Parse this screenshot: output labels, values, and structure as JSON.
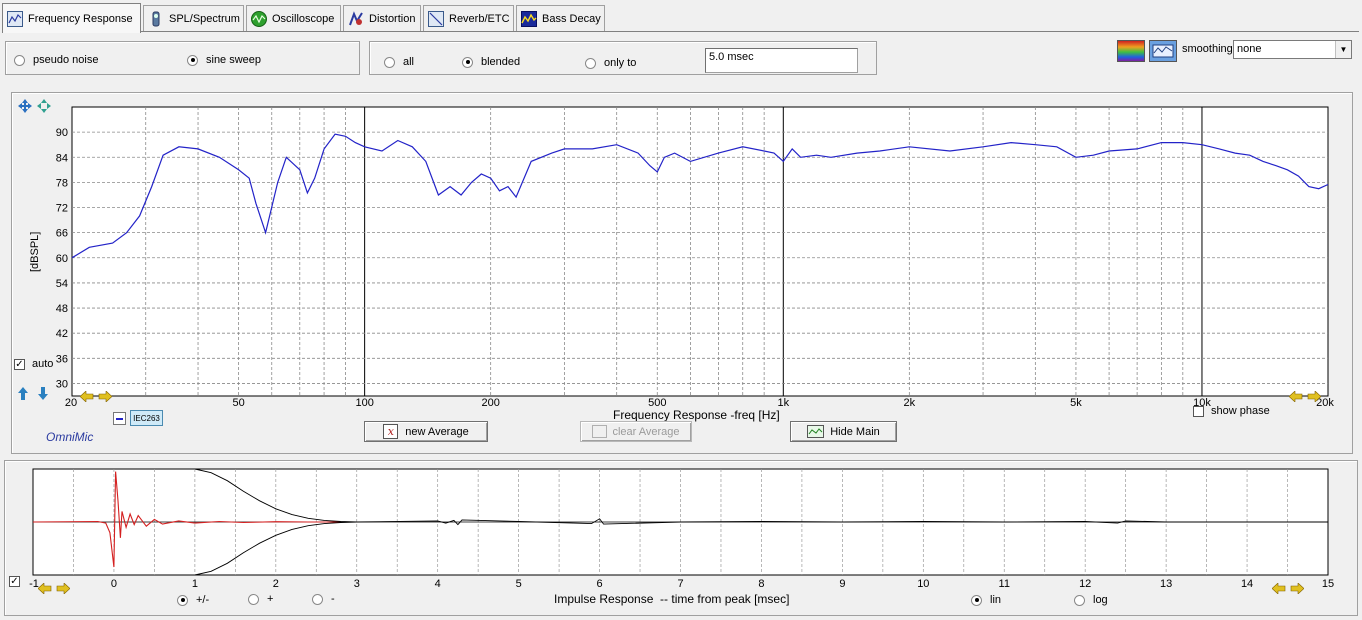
{
  "tabs": [
    {
      "label": "Frequency Response",
      "icon": "frequency-response-icon",
      "active": true
    },
    {
      "label": "SPL/Spectrum",
      "icon": "spl-meter-icon",
      "active": false
    },
    {
      "label": "Oscilloscope",
      "icon": "oscilloscope-icon",
      "active": false
    },
    {
      "label": "Distortion",
      "icon": "distortion-icon",
      "active": false
    },
    {
      "label": "Reverb/ETC",
      "icon": "reverb-icon",
      "active": false
    },
    {
      "label": "Bass Decay",
      "icon": "waterfall-icon",
      "active": false
    }
  ],
  "stimulus": {
    "options": [
      "pseudo noise",
      "sine sweep"
    ],
    "selected": "sine sweep"
  },
  "window": {
    "options": [
      "all",
      "blended",
      "only to"
    ],
    "selected": "blended",
    "only_to_value": "5.0 msec"
  },
  "smoothing": {
    "label": "smoothing",
    "value": "none"
  },
  "freq_plot": {
    "xlabel": "Frequency Response -freq [Hz]",
    "ylabel": "[dBSPL]",
    "auto_label": "auto",
    "auto_checked": true,
    "show_phase_label": "show phase",
    "show_phase_checked": false,
    "brand": "OmniMic",
    "legend_label": "IEC263",
    "line_color": "#2323c8"
  },
  "buttons": {
    "new_average": "new Average",
    "clear_average": "clear Average",
    "hide_main": "Hide Main"
  },
  "impulse_plot": {
    "xlabel": "Impulse Response  -- time from peak [msec]",
    "polarity_options": [
      "+/-",
      "+",
      "-"
    ],
    "polarity_selected": "+/-",
    "scale_options": [
      "lin",
      "log"
    ],
    "scale_selected": "lin",
    "checkbox_checked": true,
    "line_color": "#d42020"
  },
  "chart_data": [
    {
      "type": "line",
      "title": "",
      "xlabel": "Frequency Response -freq [Hz]",
      "ylabel": "[dBSPL]",
      "xscale": "log",
      "xlim": [
        20,
        20000
      ],
      "ylim": [
        27,
        96
      ],
      "x_ticks": [
        20,
        50,
        100,
        200,
        500,
        1000,
        2000,
        5000,
        10000,
        20000
      ],
      "x_tick_labels": [
        "20",
        "50",
        "100",
        "200",
        "500",
        "1k",
        "2k",
        "5k",
        "10k",
        "20k"
      ],
      "y_ticks": [
        30,
        36,
        42,
        48,
        54,
        60,
        66,
        72,
        78,
        84,
        90
      ],
      "y_tick_labels": [
        "30",
        "36",
        "42",
        "48",
        "54",
        "60",
        "66",
        "72",
        "78",
        "84",
        "90"
      ],
      "grid": true,
      "series": [
        {
          "x": [
            20,
            22,
            25,
            27,
            29,
            31,
            33,
            36,
            40,
            45,
            50,
            53,
            55,
            58,
            62,
            65,
            70,
            73,
            76,
            80,
            85,
            90,
            95,
            100,
            110,
            120,
            130,
            140,
            150,
            160,
            170,
            180,
            190,
            200,
            210,
            220,
            230,
            250,
            280,
            300,
            350,
            400,
            450,
            480,
            500,
            520,
            550,
            600,
            700,
            800,
            900,
            950,
            1000,
            1050,
            1100,
            1200,
            1300,
            1500,
            1700,
            2000,
            2500,
            3000,
            3500,
            4000,
            4500,
            5000,
            5500,
            6000,
            7000,
            8000,
            9000,
            10000,
            11000,
            12000,
            13000,
            14000,
            15000,
            16000,
            17000,
            18000,
            19000,
            20000
          ],
          "y": [
            60,
            62.5,
            63.5,
            66,
            70,
            77,
            84.5,
            86.5,
            86,
            84,
            81,
            79,
            73,
            66,
            78,
            84,
            81,
            75.5,
            79,
            86,
            89.5,
            89,
            87.5,
            86.5,
            85.5,
            88,
            86.5,
            83,
            75,
            77,
            75,
            78,
            80,
            79,
            76,
            77,
            74.5,
            83,
            85,
            86,
            86,
            87,
            85,
            82,
            80.5,
            84,
            85,
            83,
            85,
            86.5,
            85.5,
            85,
            83,
            86,
            84,
            84.5,
            84,
            85,
            85.5,
            86.5,
            85.5,
            86.5,
            87.5,
            87,
            86.5,
            84,
            84.5,
            85.5,
            86,
            87.5,
            87.5,
            87,
            86,
            85,
            84.5,
            83,
            82,
            81,
            79.5,
            77,
            76.5,
            77.5
          ]
        }
      ]
    },
    {
      "type": "line",
      "title": "",
      "xlabel": "Impulse Response  -- time from peak [msec]",
      "ylabel": "",
      "xlim": [
        -1,
        15
      ],
      "ylim": [
        -1,
        1
      ],
      "x_ticks": [
        -1,
        0,
        1,
        2,
        3,
        4,
        5,
        6,
        7,
        8,
        9,
        10,
        11,
        12,
        13,
        14,
        15
      ],
      "x_tick_labels": [
        "-1",
        "0",
        "1",
        "2",
        "3",
        "4",
        "5",
        "6",
        "7",
        "8",
        "9",
        "10",
        "11",
        "12",
        "13",
        "14",
        "15"
      ],
      "grid": true,
      "series": [
        {
          "x": [
            -1,
            -0.2,
            -0.1,
            -0.05,
            0,
            0.02,
            0.05,
            0.08,
            0.1,
            0.15,
            0.2,
            0.25,
            0.3,
            0.4,
            0.5,
            0.6,
            0.8,
            1.0,
            1.3,
            1.6,
            2.0,
            2.4,
            3.0
          ],
          "y": [
            0,
            0.01,
            -0.02,
            -0.2,
            -0.85,
            0.95,
            0.4,
            -0.3,
            0.2,
            -0.1,
            0.15,
            -0.05,
            0.12,
            -0.08,
            0.05,
            -0.04,
            0.02,
            -0.02,
            0.01,
            -0.01,
            0.005,
            0,
            0
          ]
        },
        {
          "x": [
            3.0,
            4.0,
            4.1,
            4.2,
            4.25,
            4.3,
            5.0,
            5.9,
            6.0,
            6.05,
            7.0,
            8.0,
            9.0,
            10.0,
            11.0,
            12.0,
            12.4,
            12.5,
            13.0,
            14.0,
            15.0
          ],
          "y": [
            0,
            0.02,
            -0.02,
            0.03,
            -0.05,
            0.04,
            0.01,
            -0.03,
            0.06,
            -0.04,
            0,
            0.01,
            0,
            0.01,
            0,
            0.01,
            -0.02,
            0.02,
            0,
            0,
            0
          ]
        },
        {
          "x": [
            1.0,
            1.2,
            1.4,
            1.6,
            1.8,
            2.0,
            2.2,
            2.4,
            2.6,
            2.8,
            3.0
          ],
          "y": [
            1.0,
            0.93,
            0.78,
            0.58,
            0.4,
            0.25,
            0.14,
            0.07,
            0.03,
            0.01,
            0
          ]
        },
        {
          "x": [
            1.0,
            1.2,
            1.4,
            1.6,
            1.8,
            2.0,
            2.2,
            2.4,
            2.6,
            2.8,
            3.0
          ],
          "y": [
            -1.0,
            -0.93,
            -0.78,
            -0.58,
            -0.4,
            -0.25,
            -0.14,
            -0.07,
            -0.03,
            -0.01,
            0
          ]
        }
      ]
    }
  ]
}
